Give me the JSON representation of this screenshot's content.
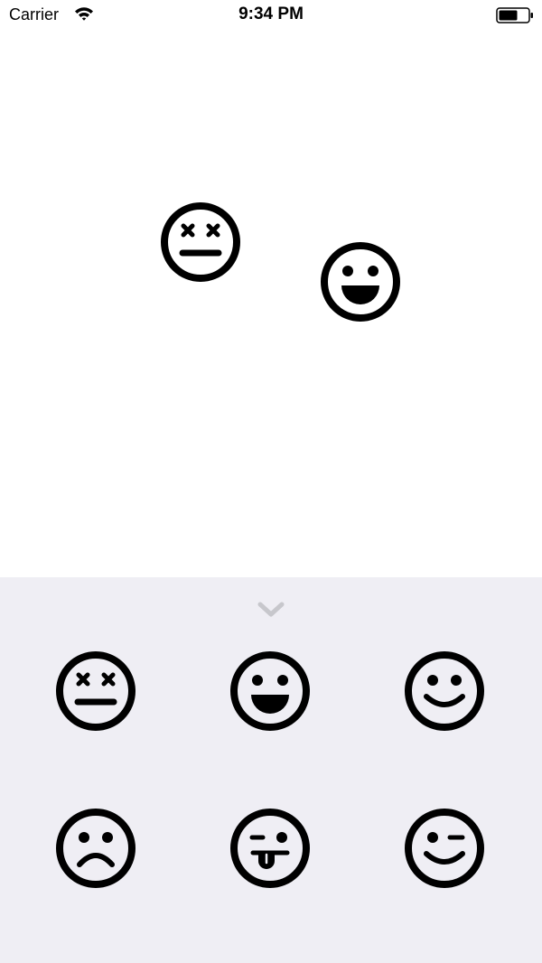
{
  "status_bar": {
    "carrier": "Carrier",
    "time": "9:34 PM",
    "wifi_icon": "wifi-icon",
    "battery_icon": "battery-icon"
  },
  "canvas": {
    "placed_stickers": [
      {
        "icon": "dead-face-icon"
      },
      {
        "icon": "grinning-face-icon"
      }
    ]
  },
  "drawer": {
    "collapse_icon": "chevron-down-icon",
    "chevron_color": "#c7c7cc",
    "background": "#efeef4",
    "stickers": [
      {
        "icon": "dead-face-icon"
      },
      {
        "icon": "grinning-face-icon"
      },
      {
        "icon": "smiling-face-icon"
      },
      {
        "icon": "sad-face-icon"
      },
      {
        "icon": "tongue-face-icon"
      },
      {
        "icon": "winking-face-icon"
      }
    ]
  }
}
